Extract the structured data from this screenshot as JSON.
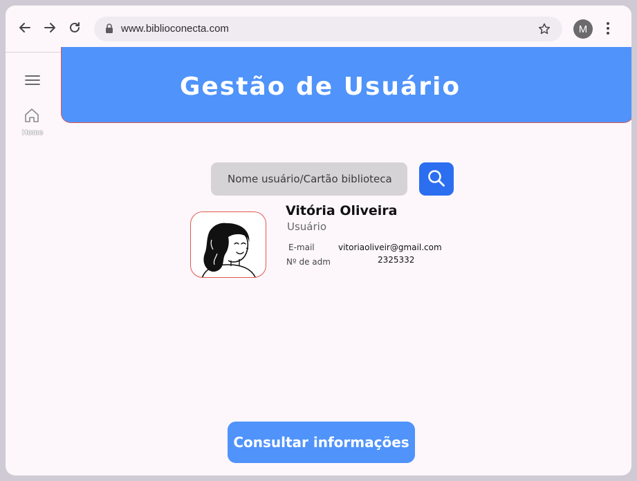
{
  "browser": {
    "url": "www.biblioconecta.com",
    "profile_initial": "M"
  },
  "rail": {
    "home_label": "Home"
  },
  "header": {
    "title": "Gestão de Usuário"
  },
  "search": {
    "placeholder": "Nome usuário/Cartão biblioteca"
  },
  "user": {
    "name": "Vitória Oliveira",
    "role": "Usuário",
    "email_label": "E-mail",
    "email": "vitoriaoliveir@gmail.com",
    "adm_label": "Nº de adm",
    "adm_number": "2325332"
  },
  "actions": {
    "consult_label": "Consultar informações"
  },
  "colors": {
    "banner": "#4f93fb",
    "border_accent": "#e0584e",
    "search_button": "#2c6ef0"
  }
}
